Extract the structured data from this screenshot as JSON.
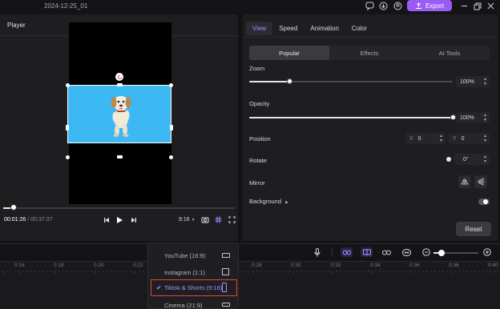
{
  "titlebar": {
    "project_name": "2024-12-25_01",
    "export_label": "Export"
  },
  "player": {
    "title": "Player",
    "current_time": "00:01:26",
    "time_separator": " / ",
    "total_time": "00:37:37",
    "aspect_ratio": "9:16",
    "progress_percent": 4
  },
  "inspector": {
    "tabs": [
      "View",
      "Speed",
      "Animation",
      "Color"
    ],
    "active_tab": "View",
    "subtabs": [
      "Popular",
      "Effects",
      "AI Tools"
    ],
    "active_subtab": "Popular",
    "zoom": {
      "label": "Zoom",
      "value": "100%",
      "level_percent": 20
    },
    "opacity": {
      "label": "Opacity",
      "value": "100%",
      "level_percent": 100
    },
    "position": {
      "label": "Position",
      "x_unit": "X",
      "x_value": "0",
      "y_unit": "Y",
      "y_value": "0"
    },
    "rotate": {
      "label": "Rotate",
      "value": "0°"
    },
    "mirror": {
      "label": "Mirror"
    },
    "background": {
      "label": "Background",
      "enabled": false
    },
    "reset_label": "Reset"
  },
  "timeline": {
    "ticks": [
      "0:16",
      "0:18",
      "0:20",
      "0:22",
      "0:28",
      "0:30",
      "0:32",
      "0:34",
      "0:36",
      "0:38",
      "0:40"
    ]
  },
  "aspect_menu": {
    "items": [
      {
        "label": "YouTube (16:9)",
        "selected": false
      },
      {
        "label": "Instagram (1:1)",
        "selected": false
      },
      {
        "label": "Tiktok & Shorts (9:16)",
        "selected": true
      },
      {
        "label": "Cinema (21:9)",
        "selected": false
      }
    ]
  },
  "colors": {
    "accent": "#9b5cf5",
    "selection_outline": "#e0454a",
    "clip_background": "#3cb9f3"
  }
}
